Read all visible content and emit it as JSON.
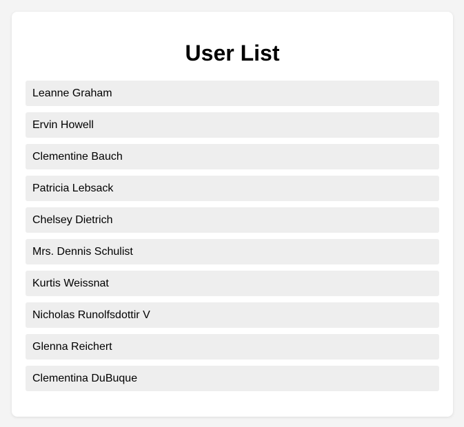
{
  "page": {
    "title": "User List"
  },
  "users": [
    {
      "name": "Leanne Graham"
    },
    {
      "name": "Ervin Howell"
    },
    {
      "name": "Clementine Bauch"
    },
    {
      "name": "Patricia Lebsack"
    },
    {
      "name": "Chelsey Dietrich"
    },
    {
      "name": "Mrs. Dennis Schulist"
    },
    {
      "name": "Kurtis Weissnat"
    },
    {
      "name": "Nicholas Runolfsdottir V"
    },
    {
      "name": "Glenna Reichert"
    },
    {
      "name": "Clementina DuBuque"
    }
  ],
  "colors": {
    "background": "#f4f4f4",
    "card": "#ffffff",
    "item": "#eeeeee",
    "text": "#000000"
  }
}
